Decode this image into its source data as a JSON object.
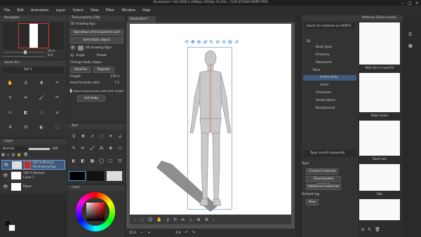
{
  "titlebar": {
    "title": "Illustration* (A4 3508 x 2480px 350dpi 25.0%) - CLIP STUDIO PAINT PRO"
  },
  "menu": [
    "File",
    "Edit",
    "Animation",
    "Layer",
    "Select",
    "View",
    "Filter",
    "Window",
    "Help"
  ],
  "navigator": {
    "title": "Navigator",
    "zoom": "25.0",
    "angle": "0.0"
  },
  "sub_tool": {
    "title": "Quick Acc",
    "set": "Set 1"
  },
  "tool_property": {
    "title": "Tool property [Obj",
    "sub_title": "3D drawing figu",
    "operation": "Operation of transparent part",
    "selectable": "Selectable object",
    "object_name": "3D drawing figur",
    "angle": "Angle",
    "preset": "Preset",
    "change_shape": "Change body shape",
    "ideal_body": "Ideal bo",
    "register": "Register",
    "height_label": "Height",
    "height_value": "135.3",
    "head_ratio_label": "Head to body ratio",
    "head_ratio_value": "7.2",
    "adjust_label": "Adjust head to body ratio with height",
    "full_body": "Full body"
  },
  "tool_panel": {
    "title": "Tool"
  },
  "color": {
    "title": "Color"
  },
  "layer": {
    "title": "Layer",
    "blend": "Normal",
    "opacity": "100",
    "layers": [
      {
        "line1": "100 % Normal",
        "line2": "3D drawing figu"
      },
      {
        "line1": "100 % Normal",
        "line2": "Layer 1"
      },
      {
        "line1": "",
        "line2": "Paper"
      }
    ]
  },
  "canvas": {
    "tab": "Illustration*",
    "zoom": "25.0",
    "angle": "0.0"
  },
  "material": {
    "title": "Material [Entire body]",
    "search_placeholder": "Search for materials on ASSETS",
    "tree": [
      "3D",
      "Body type",
      "Primitive",
      "Panorama",
      "Pose",
      "Entire body",
      "Hand",
      "Character",
      "Small object",
      "Background"
    ],
    "tree_selected": "Entire body",
    "search_keywords": "Type search keywords",
    "type_label": "Type",
    "type_buttons": [
      "Created material",
      "Downloaded material",
      "Additional materials"
    ],
    "default_tag": "Default tag",
    "pose_tag": "Pose",
    "thumbs": [
      "Rest chin in hand 01",
      "Relax (man)",
      "Touch hair",
      "Sith"
    ]
  },
  "colors": {
    "accent": "#4a8fd6",
    "figure": "#c9c9c9",
    "bone": "#e05a3a"
  }
}
